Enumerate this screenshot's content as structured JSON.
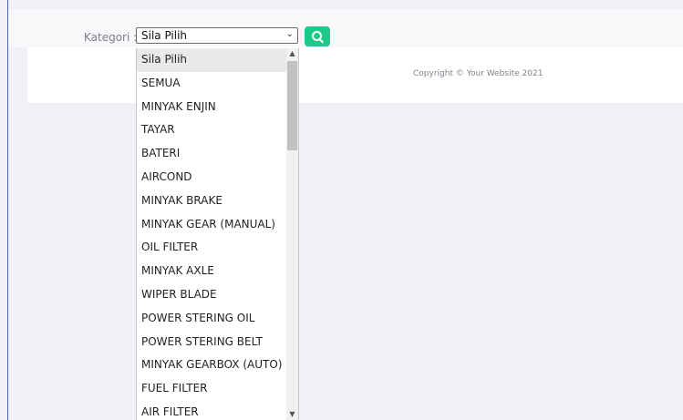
{
  "form": {
    "label": "Kategori :",
    "select_value": "Sila Pilih"
  },
  "footer": {
    "copyright": "Copyright © Your Website 2021"
  },
  "dropdown": {
    "options": [
      "Sila Pilih",
      "SEMUA",
      "MINYAK ENJIN",
      "TAYAR",
      "BATERI",
      "AIRCOND",
      "MINYAK BRAKE",
      "MINYAK GEAR (MANUAL)",
      "OIL FILTER",
      "MINYAK AXLE",
      "WIPER BLADE",
      "POWER STERING OIL",
      "POWER STERING BELT",
      "MINYAK GEARBOX (AUTO)",
      "FUEL FILTER",
      "AIR FILTER"
    ]
  }
}
